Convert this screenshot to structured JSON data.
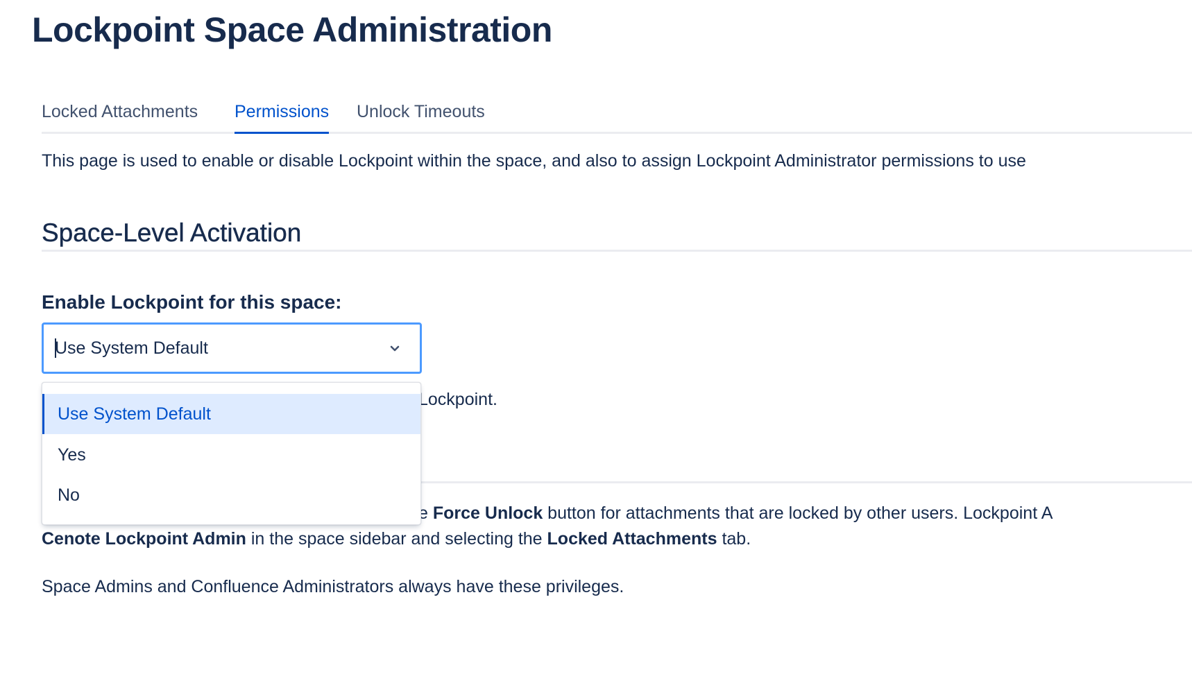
{
  "page": {
    "title": "Lockpoint Space Administration"
  },
  "tabs": [
    {
      "label": "Locked Attachments",
      "active": false
    },
    {
      "label": "Permissions",
      "active": true
    },
    {
      "label": "Unlock Timeouts",
      "active": false
    }
  ],
  "intro": {
    "text": "This page is used to enable or disable Lockpoint within the space, and also to assign Lockpoint Administrator permissions to use"
  },
  "activation": {
    "section_title": "Space-Level Activation",
    "field_label": "Enable Lockpoint for this space:",
    "select": {
      "value": "Use System Default",
      "options": [
        "Use System Default",
        "Yes",
        "No"
      ],
      "open": true
    },
    "help_visible_fragment": "Lockpoint."
  },
  "admin_info": {
    "line1_prefix": "e ",
    "line1_bold": "Force Unlock",
    "line1_suffix": " button for attachments that are locked by other users. Lockpoint A",
    "line2_bold1": "Cenote Lockpoint Admin",
    "line2_mid": " in the space sidebar and selecting the ",
    "line2_bold2": "Locked Attachments",
    "line2_suffix": " tab.",
    "note": "Space Admins and Confluence Administrators always have these privileges."
  },
  "colors": {
    "text": "#172B4D",
    "accent": "#0052CC",
    "focus_border": "#4C9AFF",
    "selected_bg": "#DEEBFF",
    "divider": "#EBECF0"
  },
  "icons": {
    "select_chevron": "chevron-down-icon"
  }
}
